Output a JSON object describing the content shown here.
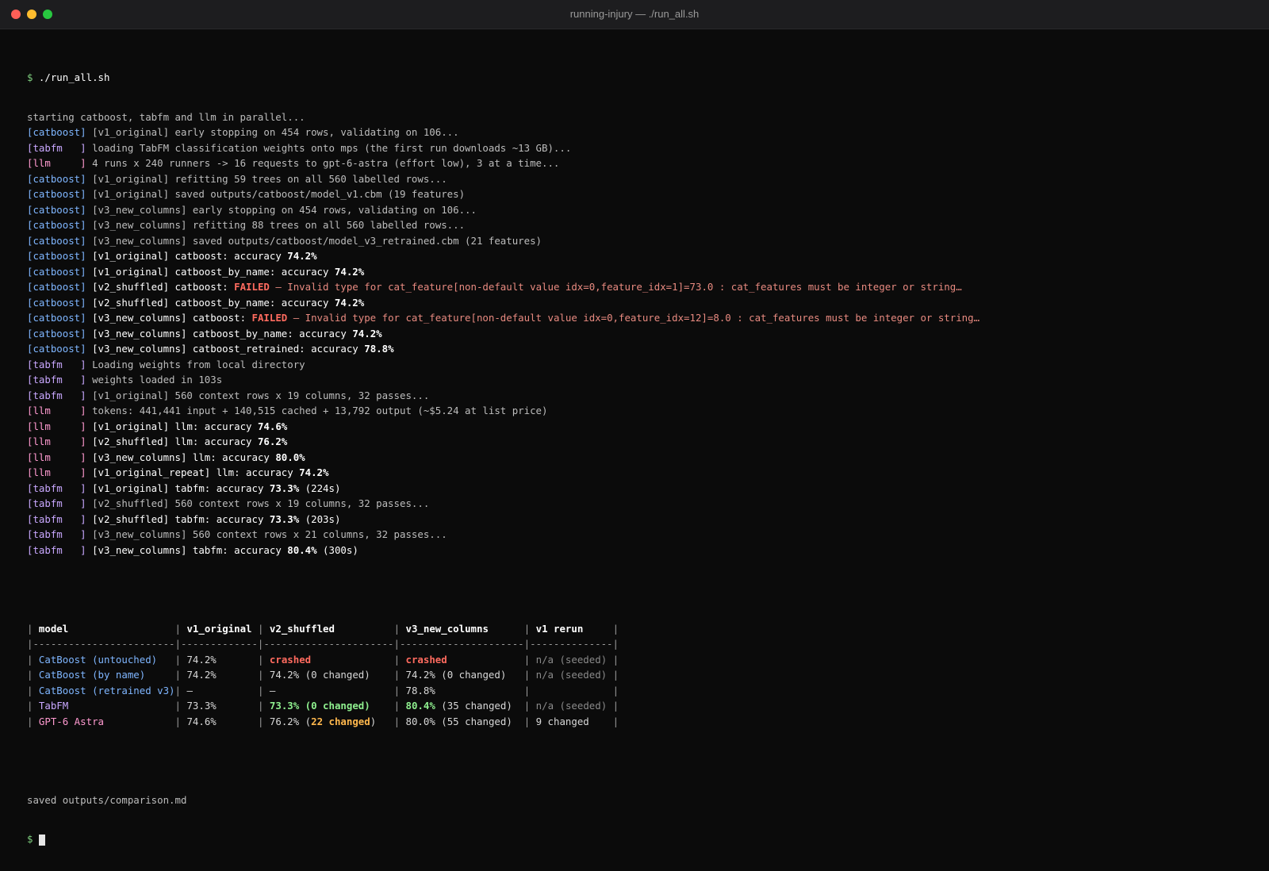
{
  "window": {
    "title": "running-injury — ./run_all.sh"
  },
  "colors": {
    "catboost": "#7fb6ff",
    "tabfm": "#c9a8ff",
    "llm": "#ff9ad0",
    "failed": "#ff6b5f",
    "success": "#8ff08f",
    "warning": "#ffb84d"
  },
  "command": {
    "prompt": "$",
    "text": " ./run_all.sh"
  },
  "log": [
    {
      "text": "starting catboost, tabfm and llm in parallel..."
    },
    {
      "tag": "[catboost]",
      "tool": "catboost",
      "rest": " [v1_original] early stopping on 454 rows, validating on 106..."
    },
    {
      "tag": "[tabfm   ]",
      "tool": "tabfm",
      "rest": " loading TabFM classification weights onto mps (the first run downloads ~13 GB)..."
    },
    {
      "tag": "[llm     ]",
      "tool": "llm",
      "rest": " 4 runs x 240 runners -> 16 requests to gpt-6-astra (effort low), 3 at a time..."
    },
    {
      "tag": "[catboost]",
      "tool": "catboost",
      "rest": " [v1_original] refitting 59 trees on all 560 labelled rows..."
    },
    {
      "tag": "[catboost]",
      "tool": "catboost",
      "rest": " [v1_original] saved outputs/catboost/model_v1.cbm (19 features)"
    },
    {
      "tag": "[catboost]",
      "tool": "catboost",
      "rest": " [v3_new_columns] early stopping on 454 rows, validating on 106..."
    },
    {
      "tag": "[catboost]",
      "tool": "catboost",
      "rest": " [v3_new_columns] refitting 88 trees on all 560 labelled rows..."
    },
    {
      "tag": "[catboost]",
      "tool": "catboost",
      "rest": " [v3_new_columns] saved outputs/catboost/model_v3_retrained.cbm (21 features)"
    },
    {
      "tag": "[catboost]",
      "tool": "catboost",
      "pre": " [v1_original] catboost: accuracy ",
      "value": "74.2%"
    },
    {
      "tag": "[catboost]",
      "tool": "catboost",
      "pre": " [v1_original] catboost_by_name: accuracy ",
      "value": "74.2%"
    },
    {
      "tag": "[catboost]",
      "tool": "catboost",
      "pre": " [v2_shuffled] catboost: ",
      "fail": "FAILED",
      "err": " — Invalid type for cat_feature[non-default value idx=0,feature_idx=1]=73.0 : cat_features must be integer or string…"
    },
    {
      "tag": "[catboost]",
      "tool": "catboost",
      "pre": " [v2_shuffled] catboost_by_name: accuracy ",
      "value": "74.2%"
    },
    {
      "tag": "[catboost]",
      "tool": "catboost",
      "pre": " [v3_new_columns] catboost: ",
      "fail": "FAILED",
      "err": " — Invalid type for cat_feature[non-default value idx=0,feature_idx=12]=8.0 : cat_features must be integer or string…"
    },
    {
      "tag": "[catboost]",
      "tool": "catboost",
      "pre": " [v3_new_columns] catboost_by_name: accuracy ",
      "value": "74.2%"
    },
    {
      "tag": "[catboost]",
      "tool": "catboost",
      "pre": " [v3_new_columns] catboost_retrained: accuracy ",
      "value": "78.8%"
    },
    {
      "tag": "[tabfm   ]",
      "tool": "tabfm",
      "rest": " Loading weights from local directory"
    },
    {
      "tag": "[tabfm   ]",
      "tool": "tabfm",
      "rest": " weights loaded in 103s"
    },
    {
      "tag": "[tabfm   ]",
      "tool": "tabfm",
      "rest": " [v1_original] 560 context rows x 19 columns, 32 passes..."
    },
    {
      "tag": "[llm     ]",
      "tool": "llm",
      "rest": " tokens: 441,441 input + 140,515 cached + 13,792 output (~$5.24 at list price)"
    },
    {
      "tag": "[llm     ]",
      "tool": "llm",
      "pre": " [v1_original] llm: accuracy ",
      "value": "74.6%"
    },
    {
      "tag": "[llm     ]",
      "tool": "llm",
      "pre": " [v2_shuffled] llm: accuracy ",
      "value": "76.2%"
    },
    {
      "tag": "[llm     ]",
      "tool": "llm",
      "pre": " [v3_new_columns] llm: accuracy ",
      "value": "80.0%"
    },
    {
      "tag": "[llm     ]",
      "tool": "llm",
      "pre": " [v1_original_repeat] llm: accuracy ",
      "value": "74.2%"
    },
    {
      "tag": "[tabfm   ]",
      "tool": "tabfm",
      "pre": " [v1_original] tabfm: accuracy ",
      "value": "73.3%",
      "post": " (224s)"
    },
    {
      "tag": "[tabfm   ]",
      "tool": "tabfm",
      "rest": " [v2_shuffled] 560 context rows x 19 columns, 32 passes..."
    },
    {
      "tag": "[tabfm   ]",
      "tool": "tabfm",
      "pre": " [v2_shuffled] tabfm: accuracy ",
      "value": "73.3%",
      "post": " (203s)"
    },
    {
      "tag": "[tabfm   ]",
      "tool": "tabfm",
      "rest": " [v3_new_columns] 560 context rows x 21 columns, 32 passes..."
    },
    {
      "tag": "[tabfm   ]",
      "tool": "tabfm",
      "pre": " [v3_new_columns] tabfm: accuracy ",
      "value": "80.4%",
      "post": " (300s)"
    }
  ],
  "table": {
    "header": [
      {
        "text": " model                  ",
        "style": "b"
      },
      {
        "text": " v1_original ",
        "style": "b"
      },
      {
        "text": " v2_shuffled          ",
        "style": "b"
      },
      {
        "text": " v3_new_columns      ",
        "style": "b"
      },
      {
        "text": " v1 rerun     ",
        "style": "b"
      }
    ],
    "separator": "|------------------------|-------------|----------------------|---------------------|--------------|",
    "rows": [
      {
        "tool": "catboost",
        "cells": [
          [
            {
              "text": " CatBoost (untouched)   ",
              "style": "t-cat"
            }
          ],
          [
            {
              "text": " 74.2%       ",
              "style": ""
            }
          ],
          [
            {
              "text": " ",
              "style": ""
            },
            {
              "text": "crashed",
              "style": "red-b"
            },
            {
              "text": "              ",
              "style": ""
            }
          ],
          [
            {
              "text": " ",
              "style": ""
            },
            {
              "text": "crashed",
              "style": "red-b"
            },
            {
              "text": "             ",
              "style": ""
            }
          ],
          [
            {
              "text": " n/a (seeded) ",
              "style": "muted"
            }
          ]
        ]
      },
      {
        "tool": "catboost",
        "cells": [
          [
            {
              "text": " CatBoost (by name)     ",
              "style": "t-cat"
            }
          ],
          [
            {
              "text": " 74.2%       ",
              "style": ""
            }
          ],
          [
            {
              "text": " 74.2% (0 changed)    ",
              "style": ""
            }
          ],
          [
            {
              "text": " 74.2% (0 changed)   ",
              "style": ""
            }
          ],
          [
            {
              "text": " n/a (seeded) ",
              "style": "muted"
            }
          ]
        ]
      },
      {
        "tool": "catboost",
        "cells": [
          [
            {
              "text": " CatBoost (retrained v3)",
              "style": "t-cat"
            }
          ],
          [
            {
              "text": " –           ",
              "style": ""
            }
          ],
          [
            {
              "text": " –                    ",
              "style": ""
            }
          ],
          [
            {
              "text": " 78.8%               ",
              "style": ""
            }
          ],
          [
            {
              "text": "              ",
              "style": ""
            }
          ]
        ]
      },
      {
        "tool": "tabfm",
        "cells": [
          [
            {
              "text": " TabFM                  ",
              "style": "t-tab"
            }
          ],
          [
            {
              "text": " 73.3%       ",
              "style": ""
            }
          ],
          [
            {
              "text": " ",
              "style": ""
            },
            {
              "text": "73.3% (0 changed)",
              "style": "green-b"
            },
            {
              "text": "    ",
              "style": ""
            }
          ],
          [
            {
              "text": " ",
              "style": ""
            },
            {
              "text": "80.4%",
              "style": "green-b"
            },
            {
              "text": " (35 changed)  ",
              "style": ""
            }
          ],
          [
            {
              "text": " n/a (seeded) ",
              "style": "muted"
            }
          ]
        ]
      },
      {
        "tool": "llm",
        "cells": [
          [
            {
              "text": " GPT-6 Astra            ",
              "style": "t-llm"
            }
          ],
          [
            {
              "text": " 74.6%       ",
              "style": ""
            }
          ],
          [
            {
              "text": " 76.2% (",
              "style": ""
            },
            {
              "text": "22 changed",
              "style": "orange-b"
            },
            {
              "text": ")   ",
              "style": ""
            }
          ],
          [
            {
              "text": " 80.0% (55 changed)  ",
              "style": ""
            }
          ],
          [
            {
              "text": " 9 changed    ",
              "style": ""
            }
          ]
        ]
      }
    ]
  },
  "saved": "saved outputs/comparison.md",
  "final_prompt": "$ "
}
